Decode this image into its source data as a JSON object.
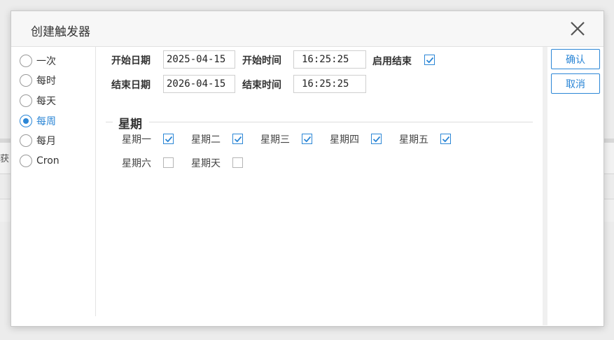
{
  "dialog": {
    "title": "创建触发器",
    "close_icon": "close-icon"
  },
  "background": {
    "peek_text": "获"
  },
  "frequency": {
    "options": [
      "一次",
      "每时",
      "每天",
      "每周",
      "每月",
      "Cron"
    ],
    "selected": "每周"
  },
  "schedule": {
    "start_date_label": "开始日期",
    "start_date_value": "2025-04-15",
    "start_time_label": "开始时间",
    "start_time_value": "16:25:25",
    "enable_end_label": "启用结束",
    "enable_end_checked": true,
    "end_date_label": "结束日期",
    "end_date_value": "2026-04-15",
    "end_time_label": "结束时间",
    "end_time_value": "16:25:25"
  },
  "weekdays": {
    "legend": "星期",
    "days": [
      {
        "label": "星期一",
        "checked": true
      },
      {
        "label": "星期二",
        "checked": true
      },
      {
        "label": "星期三",
        "checked": true
      },
      {
        "label": "星期四",
        "checked": true
      },
      {
        "label": "星期五",
        "checked": true
      },
      {
        "label": "星期六",
        "checked": false
      },
      {
        "label": "星期天",
        "checked": false
      }
    ]
  },
  "actions": {
    "confirm_label": "确认",
    "cancel_label": "取消"
  },
  "colors": {
    "accent": "#2b86d6"
  }
}
